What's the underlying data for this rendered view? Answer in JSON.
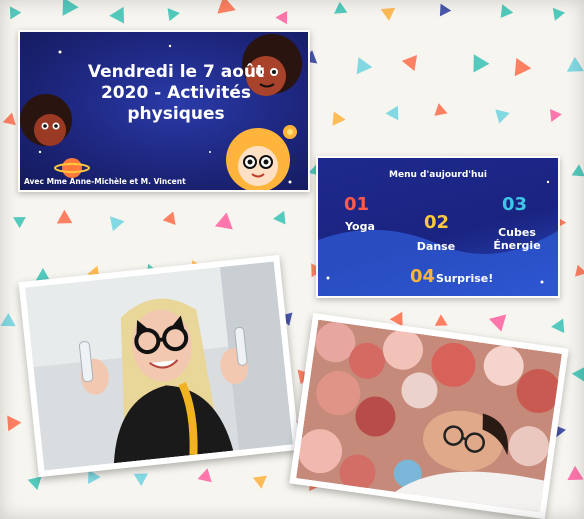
{
  "title_card": {
    "title": "Vendredi le 7 août 2020 - Activités physiques",
    "subtitle": "Avec Mme Anne-Michèle et M. Vincent"
  },
  "menu_card": {
    "heading": "Menu d'aujourd'hui",
    "items": [
      {
        "number": "01",
        "label": "Yoga",
        "number_color": "#ff5a4a"
      },
      {
        "number": "02",
        "label": "Danse",
        "number_color": "#ffc93c"
      },
      {
        "number": "03",
        "label": "Cubes Énergie",
        "number_color": "#3ec6e6"
      },
      {
        "number": "04",
        "label": "Surprise!",
        "number_color": "#ffb23c"
      }
    ]
  },
  "photos": [
    {
      "subject": "woman-with-cat-glasses"
    },
    {
      "subject": "man-with-balloons"
    }
  ],
  "colors": {
    "card_navy": "#1c2478",
    "confetti": [
      "#ff6b4a",
      "#2b3a9e",
      "#36c2b4",
      "#ff5fa0",
      "#ffb23c",
      "#6fd3e0"
    ]
  }
}
